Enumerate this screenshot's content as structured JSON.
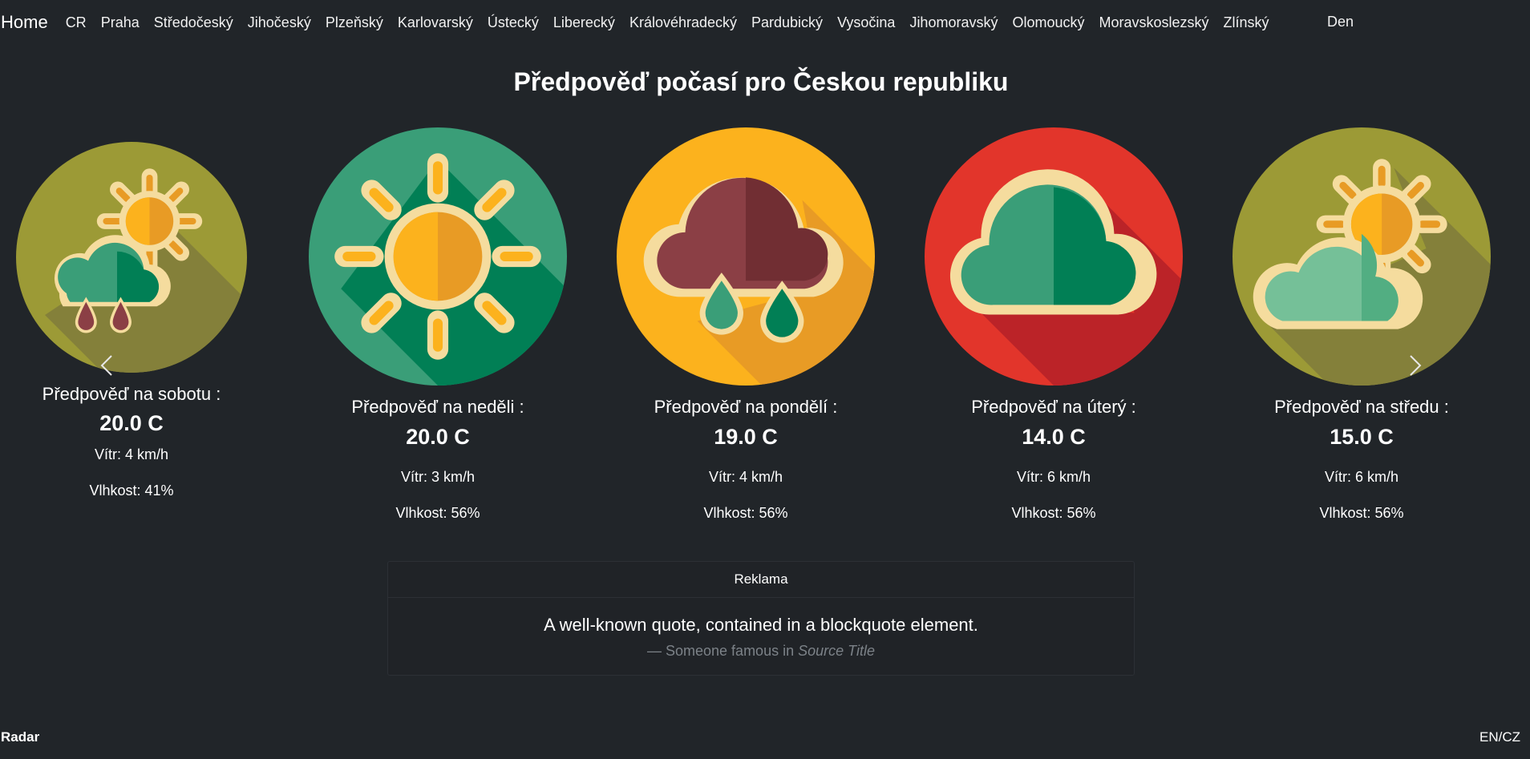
{
  "nav": {
    "brand": "Home",
    "links": [
      "CR",
      "Praha",
      "Středočeský",
      "Jihočeský",
      "Plzeňský",
      "Karlovarský",
      "Ústecký",
      "Liberecký",
      "Královéhradecký",
      "Pardubický",
      "Vysočina",
      "Jihomoravský",
      "Olomoucký",
      "Moravskoslezský",
      "Zlínský"
    ],
    "mode": "Den"
  },
  "title": "Předpověď počasí pro Českou republiku",
  "forecast": [
    {
      "heading": "Předpověď na sobotu :",
      "temp": "20.0 C",
      "wind": "Vítr: 4 km/h",
      "humidity": "Vlhkost: 41%",
      "icon": "sun-cloud-rain-icon",
      "bg": "#9c9a36"
    },
    {
      "heading": "Předpověď na neděli :",
      "temp": "20.0 C",
      "wind": "Vítr: 3 km/h",
      "humidity": "Vlhkost: 56%",
      "icon": "sun-icon",
      "bg": "#3a9e78"
    },
    {
      "heading": "Předpověď na pondělí :",
      "temp": "19.0 C",
      "wind": "Vítr: 4 km/h",
      "humidity": "Vlhkost: 56%",
      "icon": "rain-cloud-icon",
      "bg": "#fcb21d"
    },
    {
      "heading": "Předpověď na úterý :",
      "temp": "14.0 C",
      "wind": "Vítr: 6 km/h",
      "humidity": "Vlhkost: 56%",
      "icon": "cloud-icon",
      "bg": "#e2352b"
    },
    {
      "heading": "Předpověď na středu :",
      "temp": "15.0 C",
      "wind": "Vítr: 6 km/h",
      "humidity": "Vlhkost: 56%",
      "icon": "partly-cloudy-icon",
      "bg": "#9c9a36"
    }
  ],
  "ad": {
    "header": "Reklama",
    "quote": "A well-known quote, contained in a blockquote element.",
    "footer_prefix": "— Someone famous in ",
    "source": "Source Title"
  },
  "footer": {
    "radar": "Radar",
    "lang": "EN/CZ"
  },
  "colors": {
    "background": "#212529",
    "sun": "#fcb21d",
    "sun_dark": "#e89b25",
    "rim": "#f5dc9e",
    "green": "#3a9e78",
    "green_dark": "#017f55",
    "rain_cloud": "#8b3f45",
    "rain_cloud_dark": "#712e33"
  }
}
